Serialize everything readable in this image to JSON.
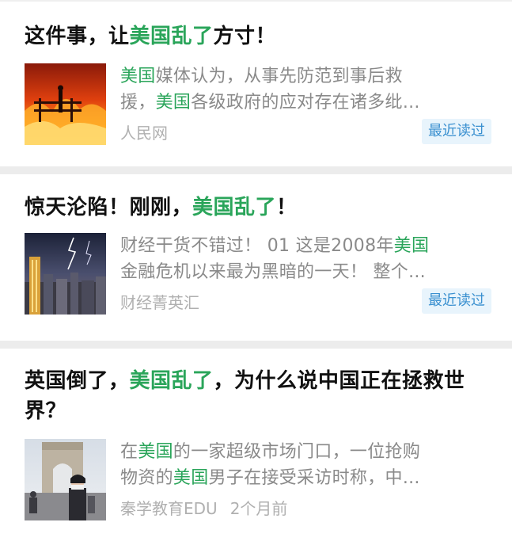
{
  "articles": [
    {
      "title": [
        {
          "text": "这件事，让",
          "hl": false
        },
        {
          "text": "美国乱了",
          "hl": true
        },
        {
          "text": "方寸！",
          "hl": false
        }
      ],
      "snippet_line1": [
        {
          "text": "美国",
          "hl": true
        },
        {
          "text": "媒体认为，从事先防范到事后救",
          "hl": false
        }
      ],
      "snippet_line2": [
        {
          "text": "援，",
          "hl": false
        },
        {
          "text": "美国",
          "hl": true
        },
        {
          "text": "各级政府的应对存在诸多纰...",
          "hl": false
        }
      ],
      "source": "人民网",
      "time": "",
      "badge": "最近读过",
      "thumb_icon": "wildfire-photo"
    },
    {
      "title": [
        {
          "text": "惊天沦陷！刚刚，",
          "hl": false
        },
        {
          "text": "美国乱了",
          "hl": true
        },
        {
          "text": "！",
          "hl": false
        }
      ],
      "snippet_line1": [
        {
          "text": "财经干货不错过！ 01 这是2008年",
          "hl": false
        },
        {
          "text": "美国",
          "hl": true
        }
      ],
      "snippet_line2": [
        {
          "text": "金融危机以来最为黑暗的一天！ 整个...",
          "hl": false
        }
      ],
      "source": "财经菁英汇",
      "time": "",
      "badge": "最近读过",
      "thumb_icon": "city-lightning-photo"
    },
    {
      "title": [
        {
          "text": "英国倒了，",
          "hl": false
        },
        {
          "text": "美国乱了",
          "hl": true
        },
        {
          "text": "，为什么说中国正在拯救世界？",
          "hl": false
        }
      ],
      "snippet_line1": [
        {
          "text": "在",
          "hl": false
        },
        {
          "text": "美国",
          "hl": true
        },
        {
          "text": "的一家超级市场门口，一位抢购",
          "hl": false
        }
      ],
      "snippet_line2": [
        {
          "text": "物资的",
          "hl": false
        },
        {
          "text": "美国",
          "hl": true
        },
        {
          "text": "男子在接受采访时称，中...",
          "hl": false
        }
      ],
      "source": "秦学教育EDU",
      "time": "2个月前",
      "badge": "",
      "thumb_icon": "arc-de-triomphe-photo"
    }
  ],
  "colors": {
    "highlight": "#2aa55a",
    "badge_bg": "#e8f4fc",
    "badge_text": "#3a90d0"
  }
}
